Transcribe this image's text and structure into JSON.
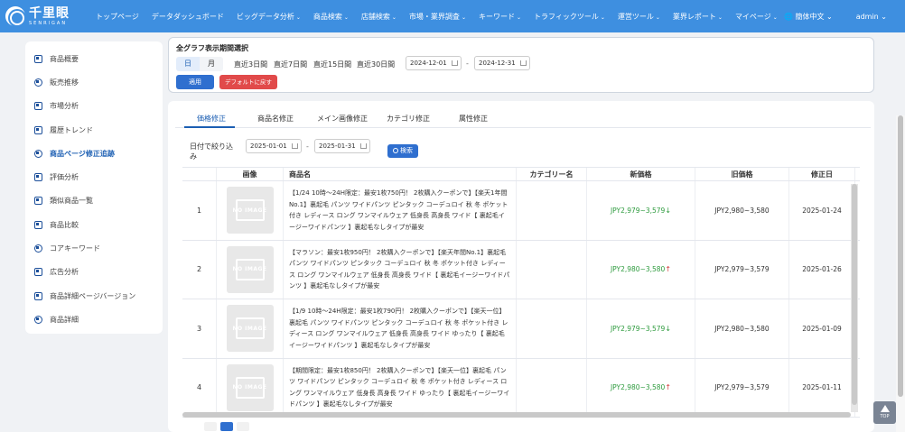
{
  "brand": {
    "name": "千里眼",
    "sub": "SENRIGAN"
  },
  "nav": [
    {
      "label": "トップページ",
      "dropdown": false
    },
    {
      "label": "データダッシュボード",
      "dropdown": false
    },
    {
      "label": "ビッグデータ分析",
      "dropdown": true
    },
    {
      "label": "商品検索",
      "dropdown": true
    },
    {
      "label": "店舗検索",
      "dropdown": true
    },
    {
      "label": "市場・業界調査",
      "dropdown": true
    },
    {
      "label": "キーワード",
      "dropdown": true
    },
    {
      "label": "トラフィックツール",
      "dropdown": true
    },
    {
      "label": "運営ツール",
      "dropdown": true
    },
    {
      "label": "業界レポート",
      "dropdown": true
    },
    {
      "label": "マイページ",
      "dropdown": true
    }
  ],
  "lang": "🌐 簡体中文 ⌄",
  "user": "admin ⌄",
  "sidebar": [
    {
      "label": "商品概要",
      "icon": "document-icon",
      "active": false
    },
    {
      "label": "販売推移",
      "icon": "pie-chart-icon",
      "active": false
    },
    {
      "label": "市場分析",
      "icon": "chart-icon",
      "active": false
    },
    {
      "label": "履歴トレンド",
      "icon": "trend-icon",
      "active": false
    },
    {
      "label": "商品ページ修正追跡",
      "icon": "target-icon",
      "active": true
    },
    {
      "label": "評価分析",
      "icon": "rating-icon",
      "active": false
    },
    {
      "label": "類似商品一覧",
      "icon": "bookmark-icon",
      "active": false
    },
    {
      "label": "商品比較",
      "icon": "compare-icon",
      "active": false
    },
    {
      "label": "コアキーワード",
      "icon": "search-icon",
      "active": false
    },
    {
      "label": "広告分析",
      "icon": "ad-icon",
      "active": false
    },
    {
      "label": "商品詳細ページバージョン",
      "icon": "page-icon",
      "active": false
    },
    {
      "label": "商品詳細",
      "icon": "detail-icon",
      "active": false
    }
  ],
  "period": {
    "title": "全グラフ表示期間選択",
    "day": "日",
    "month": "月",
    "quick": [
      "直近3日間",
      "直近7日間",
      "直近15日間",
      "直近30日間"
    ],
    "start": "2024-12-01",
    "end": "2024-12-31",
    "apply": "適用",
    "reset": "デフォルトに戻す"
  },
  "tabs": [
    "価格修正",
    "商品名修正",
    "メイン画像修正",
    "カテゴリ修正",
    "属性修正"
  ],
  "filter": {
    "label": "日付で絞り込み",
    "start": "2025-01-01",
    "end": "2025-01-31",
    "search": "検索"
  },
  "columns": [
    "画像",
    "商品名",
    "カテゴリー名",
    "新価格",
    "旧価格",
    "修正日"
  ],
  "no_image": "NO IMAGE",
  "rows": [
    {
      "idx": "1",
      "name": "【1/24 10時～24H限定：最安1枚750円！ 2枚購入クーポンで】【楽天1年間No.1】裏起毛 パンツ ワイドパンツ ピンタック コーデュロイ 秋 冬 ポケット付き レディース ロング ワンマイルウェア 低身長 高身長 ワイド【 裏起毛イージーワイドパンツ 】裏起毛なしタイプが最安",
      "category": "",
      "new_price": "JPY2,979~3,579",
      "dir": "↓",
      "old_price": "JPY2,980~3,580",
      "date": "2025-01-24"
    },
    {
      "idx": "2",
      "name": "【マラソン：最安1枚950円！ 2枚購入クーポンで】【楽天年間No.1】裏起毛 パンツ ワイドパンツ ピンタック コーデュロイ 秋 冬 ポケット付き レディース ロング ワンマイルウェア 低身長 高身長 ワイド【 裏起毛イージーワイドパンツ 】裏起毛なしタイプが最安",
      "category": "",
      "new_price": "JPY2,980~3,580",
      "dir": "↑",
      "old_price": "JPY2,979~3,579",
      "date": "2025-01-26"
    },
    {
      "idx": "3",
      "name": "【1/9 10時～24H限定：最安1枚790円！ 2枚購入クーポンで】【楽天一位】裏起毛 パンツ ワイドパンツ ピンタック コーデュロイ 秋 冬 ポケット付き レディース ロング ワンマイルウェア 低身長 高身長 ワイド ゆったり【 裏起毛イージーワイドパンツ 】裏起毛なしタイプが最安",
      "category": "",
      "new_price": "JPY2,979~3,579",
      "dir": "↓",
      "old_price": "JPY2,980~3,580",
      "date": "2025-01-09"
    },
    {
      "idx": "4",
      "name": "【期間限定：最安1枚850円！ 2枚購入クーポンで】【楽天一位】裏起毛 パンツ ワイドパンツ ピンタック コーデュロイ 秋 冬 ポケット付き レディース ロング ワンマイルウェア 低身長 高身長 ワイド ゆったり【 裏起毛イージーワイドパンツ 】裏起毛なしタイプが最安",
      "category": "",
      "new_price": "JPY2,980~3,580",
      "dir": "↑",
      "old_price": "JPY2,979~3,579",
      "date": "2025-01-11"
    }
  ],
  "backtop": "TOP"
}
